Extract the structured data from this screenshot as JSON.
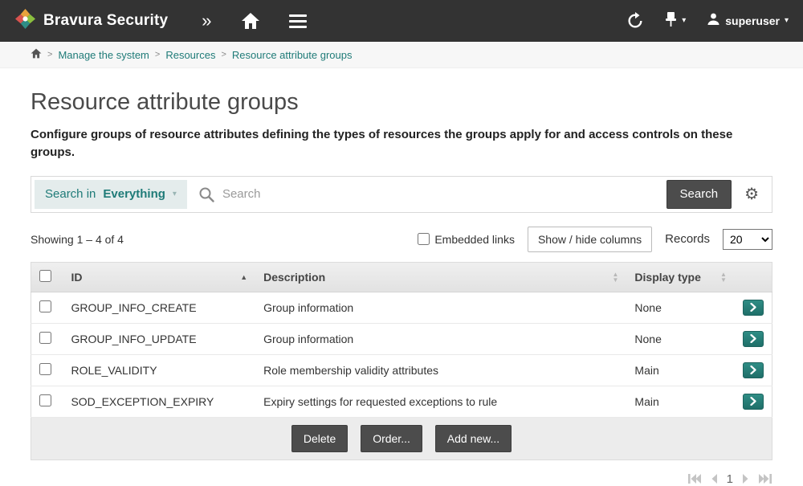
{
  "navbar": {
    "brand": "Bravura Security",
    "user_label": "superuser"
  },
  "icons": {
    "expand": "»",
    "caret_down": "▾",
    "gear": "⚙",
    "sort_asc": "▲",
    "sort_up": "▲",
    "sort_down": "▼"
  },
  "breadcrumb": {
    "items": [
      "Manage the system",
      "Resources",
      "Resource attribute groups"
    ]
  },
  "page": {
    "title": "Resource attribute groups",
    "description": "Configure groups of resource attributes defining the types of resources the groups apply for and access controls on these groups."
  },
  "search": {
    "scope_label": "Search in",
    "scope_value": "Everything",
    "placeholder": "Search",
    "submit_label": "Search"
  },
  "list_controls": {
    "showing": "Showing 1 – 4 of 4",
    "embedded_links_label": "Embedded links",
    "show_hide_label": "Show / hide columns",
    "records_label": "Records",
    "records_value": "20"
  },
  "table": {
    "headers": [
      "ID",
      "Description",
      "Display type"
    ],
    "rows": [
      {
        "id": "GROUP_INFO_CREATE",
        "description": "Group information",
        "display_type": "None"
      },
      {
        "id": "GROUP_INFO_UPDATE",
        "description": "Group information",
        "display_type": "None"
      },
      {
        "id": "ROLE_VALIDITY",
        "description": "Role membership validity attributes",
        "display_type": "Main"
      },
      {
        "id": "SOD_EXCEPTION_EXPIRY",
        "description": "Expiry settings for requested exceptions to rule",
        "display_type": "Main"
      }
    ],
    "footer_actions": [
      "Delete",
      "Order...",
      "Add new..."
    ]
  },
  "pagination": {
    "current_page": "1"
  },
  "colors": {
    "accent_teal": "#1f7b78",
    "navbar_bg": "#333333",
    "button_dark": "#4c4c4c"
  }
}
